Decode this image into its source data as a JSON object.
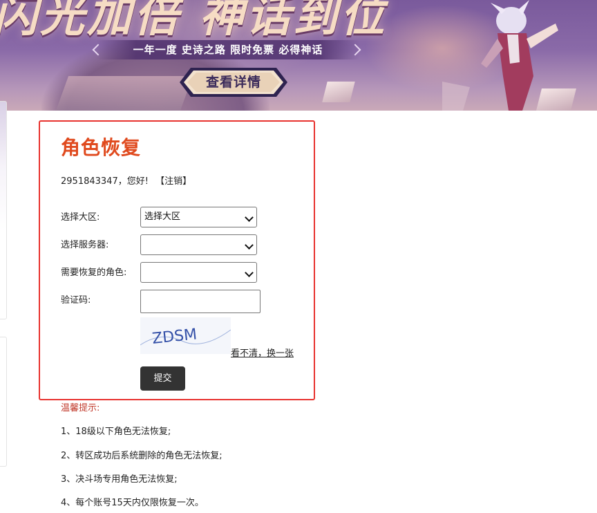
{
  "banner": {
    "headline": "闪光加倍 神话到位",
    "ribbon_text": "一年一度 史诗之路 限时免票 必得神话",
    "detail_button": "查看详情"
  },
  "form": {
    "title": "角色恢复",
    "greeting_user": "2951843347，您好!",
    "logout_label": "【注销】",
    "region_label": "选择大区:",
    "region_value": "选择大区",
    "server_label": "选择服务器:",
    "server_value": "",
    "role_label": "需要恢复的角色:",
    "role_value": "",
    "captcha_label": "验证码:",
    "captcha_text": "ZDSM",
    "refresh_label": "看不清，换一张",
    "submit_label": "提交"
  },
  "tips": {
    "title": "温馨提示:",
    "items": [
      "1、18级以下角色无法恢复;",
      "2、转区成功后系统删除的角色无法恢复;",
      "3、决斗场专用角色无法恢复;",
      "4、每个账号15天内仅限恢复一次。"
    ]
  },
  "colors": {
    "panel_border": "#e8322e",
    "title": "#e04a1e",
    "tips_title": "#c0392b",
    "submit_bg": "#333333"
  }
}
